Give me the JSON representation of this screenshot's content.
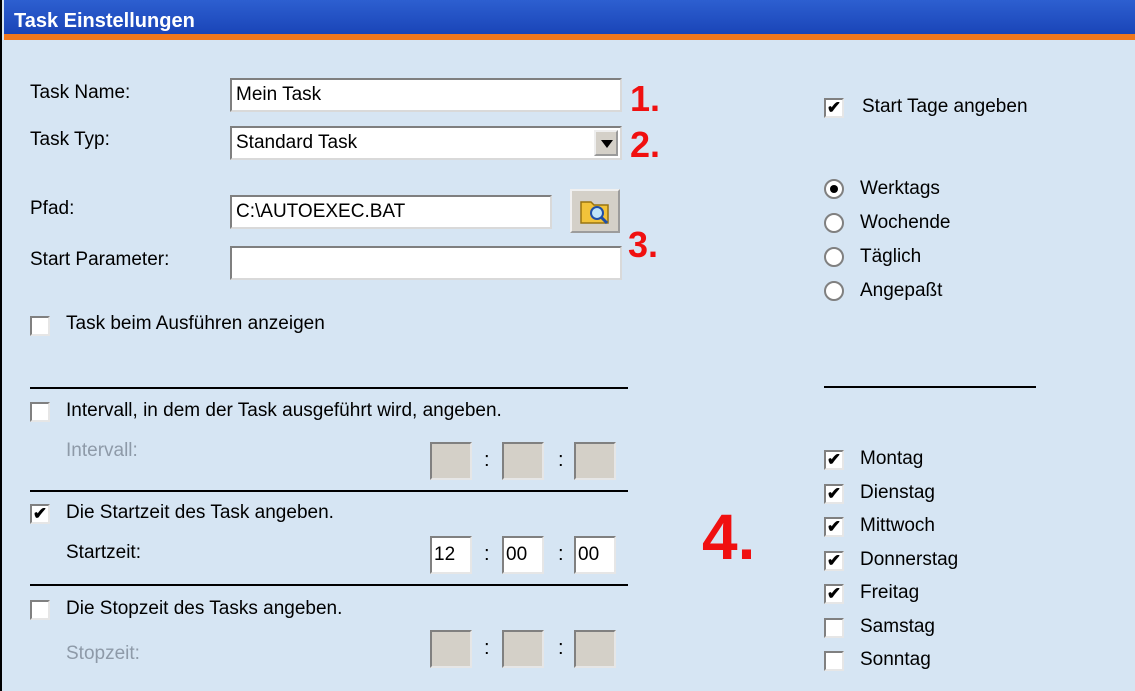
{
  "title": "Task Einstellungen",
  "task_name": {
    "label": "Task Name:",
    "value": "Mein Task"
  },
  "task_typ": {
    "label": "Task Typ:",
    "value": "Standard Task"
  },
  "pfad": {
    "label": "Pfad:",
    "value": "C:\\AUTOEXEC.BAT"
  },
  "start_parameter": {
    "label": "Start Parameter:",
    "value": ""
  },
  "show_task": {
    "label": "Task beim Ausführen anzeigen",
    "checked": false
  },
  "interval": {
    "label": "Intervall, in dem der Task ausgeführt wird, angeben.",
    "checked": false,
    "field_label": "Intervall:",
    "values": [
      "",
      "",
      ""
    ]
  },
  "startzeit": {
    "label": "Die Startzeit des Task angeben.",
    "checked": true,
    "field_label": "Startzeit:",
    "values": [
      "12",
      "00",
      "00"
    ]
  },
  "stopzeit": {
    "label": "Die Stopzeit des Tasks angeben.",
    "checked": false,
    "field_label": "Stopzeit:",
    "values": [
      "",
      "",
      ""
    ]
  },
  "time_separator": ":",
  "start_tage": {
    "label": "Start Tage angeben",
    "checked": true
  },
  "radios": [
    {
      "label": "Werktags",
      "selected": true
    },
    {
      "label": "Wochende",
      "selected": false
    },
    {
      "label": "Täglich",
      "selected": false
    },
    {
      "label": "Angepaßt",
      "selected": false
    }
  ],
  "days": [
    {
      "label": "Montag",
      "checked": true
    },
    {
      "label": "Dienstag",
      "checked": true
    },
    {
      "label": "Mittwoch",
      "checked": true
    },
    {
      "label": "Donnerstag",
      "checked": true
    },
    {
      "label": "Freitag",
      "checked": true
    },
    {
      "label": "Samstag",
      "checked": false
    },
    {
      "label": "Sonntag",
      "checked": false
    }
  ],
  "markers": [
    "1.",
    "2.",
    "3.",
    "4."
  ],
  "check_glyph": "✔",
  "colors": {
    "title_bg": "#1a45b8",
    "accent": "#f0781e",
    "panel_bg": "#d6e5f3",
    "marker": "#f01010"
  }
}
